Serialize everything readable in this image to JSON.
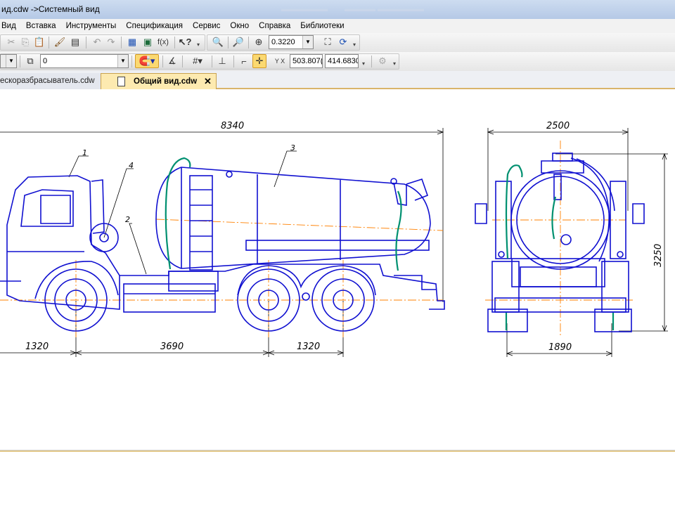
{
  "window": {
    "title": "ид.cdw ->Системный вид"
  },
  "menu": {
    "items": [
      "Вид",
      "Вставка",
      "Инструменты",
      "Спецификация",
      "Сервис",
      "Окно",
      "Справка",
      "Библиотеки"
    ]
  },
  "toolbar": {
    "zoom_value": "0.3220",
    "layer_value": "0",
    "coord_x": "503.807(",
    "coord_y": "414.6830",
    "coord_label": "Y X"
  },
  "tabs": [
    {
      "label": "ескоразбрасыватель.cdw",
      "active": false
    },
    {
      "label": "Общий вид.cdw",
      "active": true
    }
  ],
  "drawing": {
    "dim_overall_length": "8340",
    "dim_axle1": "1320",
    "dim_wheelbase": "3690",
    "dim_axle2": "1320",
    "dim_width": "2500",
    "dim_height": "3250",
    "dim_track": "1890",
    "callouts": [
      "1",
      "2",
      "3",
      "4"
    ],
    "line_color": "#1010d0",
    "axis_color": "#ff8000",
    "hose_color": "#009070",
    "dim_color": "#000000"
  }
}
